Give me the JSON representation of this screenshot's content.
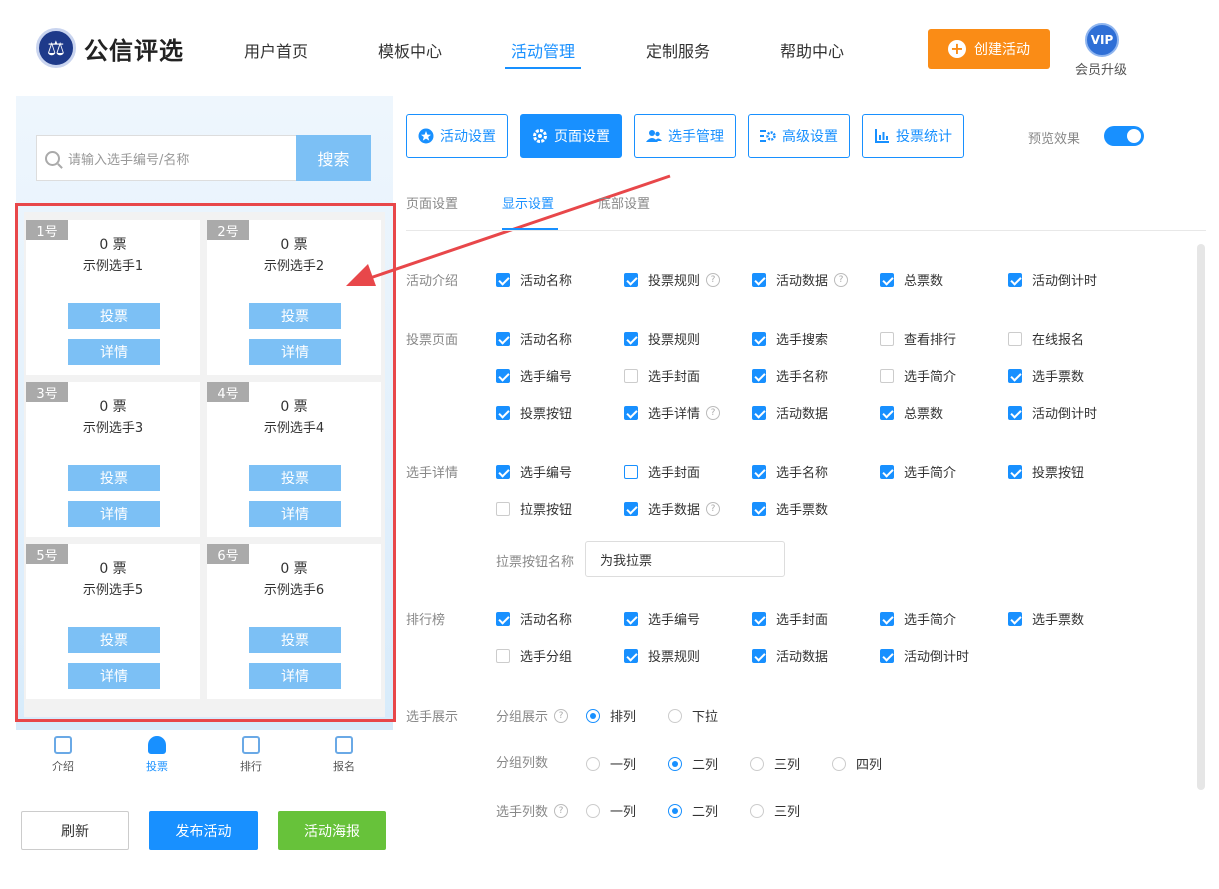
{
  "header": {
    "logo_text": "公信评选",
    "nav": [
      "用户首页",
      "模板中心",
      "活动管理",
      "定制服务",
      "帮助中心"
    ],
    "create_label": "创建活动",
    "vip_badge": "VIP",
    "vip_label": "会员升级"
  },
  "preview": {
    "search_placeholder": "请输入选手编号/名称",
    "search_button": "搜索",
    "vote_button": "投票",
    "detail_button": "详情",
    "cards": [
      {
        "badge": "1号",
        "votes": "0 票",
        "name": "示例选手1"
      },
      {
        "badge": "2号",
        "votes": "0 票",
        "name": "示例选手2"
      },
      {
        "badge": "3号",
        "votes": "0 票",
        "name": "示例选手3"
      },
      {
        "badge": "4号",
        "votes": "0 票",
        "name": "示例选手4"
      },
      {
        "badge": "5号",
        "votes": "0 票",
        "name": "示例选手5"
      },
      {
        "badge": "6号",
        "votes": "0 票",
        "name": "示例选手6"
      }
    ],
    "tabs": [
      "介绍",
      "投票",
      "排行",
      "报名"
    ],
    "actions": {
      "refresh": "刷新",
      "publish": "发布活动",
      "poster": "活动海报"
    }
  },
  "settings": {
    "top_tabs": [
      "活动设置",
      "页面设置",
      "选手管理",
      "高级设置",
      "投票统计"
    ],
    "preview_label": "预览效果",
    "sub_tabs": [
      "页面设置",
      "显示设置",
      "底部设置"
    ],
    "sections": {
      "intro": "活动介绍",
      "vote_page": "投票页面",
      "detail": "选手详情",
      "ranking": "排行榜",
      "display": "选手展示"
    },
    "opts": {
      "activity_name": "活动名称",
      "vote_rules": "投票规则",
      "activity_data": "活动数据",
      "total_votes": "总票数",
      "countdown": "活动倒计时",
      "player_search": "选手搜索",
      "view_rank": "查看排行",
      "online_signup": "在线报名",
      "player_no": "选手编号",
      "player_cover": "选手封面",
      "player_name": "选手名称",
      "player_intro": "选手简介",
      "player_votes": "选手票数",
      "vote_button": "投票按钮",
      "player_detail": "选手详情",
      "canvass_button": "拉票按钮",
      "player_data": "选手数据",
      "player_group": "选手分组"
    },
    "canvass_label": "拉票按钮名称",
    "canvass_value": "为我拉票",
    "group_display_label": "分组展示",
    "group_display_opts": [
      "排列",
      "下拉"
    ],
    "group_cols_label": "分组列数",
    "group_cols_opts": [
      "一列",
      "二列",
      "三列",
      "四列"
    ],
    "player_cols_label": "选手列数",
    "player_cols_opts": [
      "一列",
      "二列",
      "三列"
    ]
  }
}
